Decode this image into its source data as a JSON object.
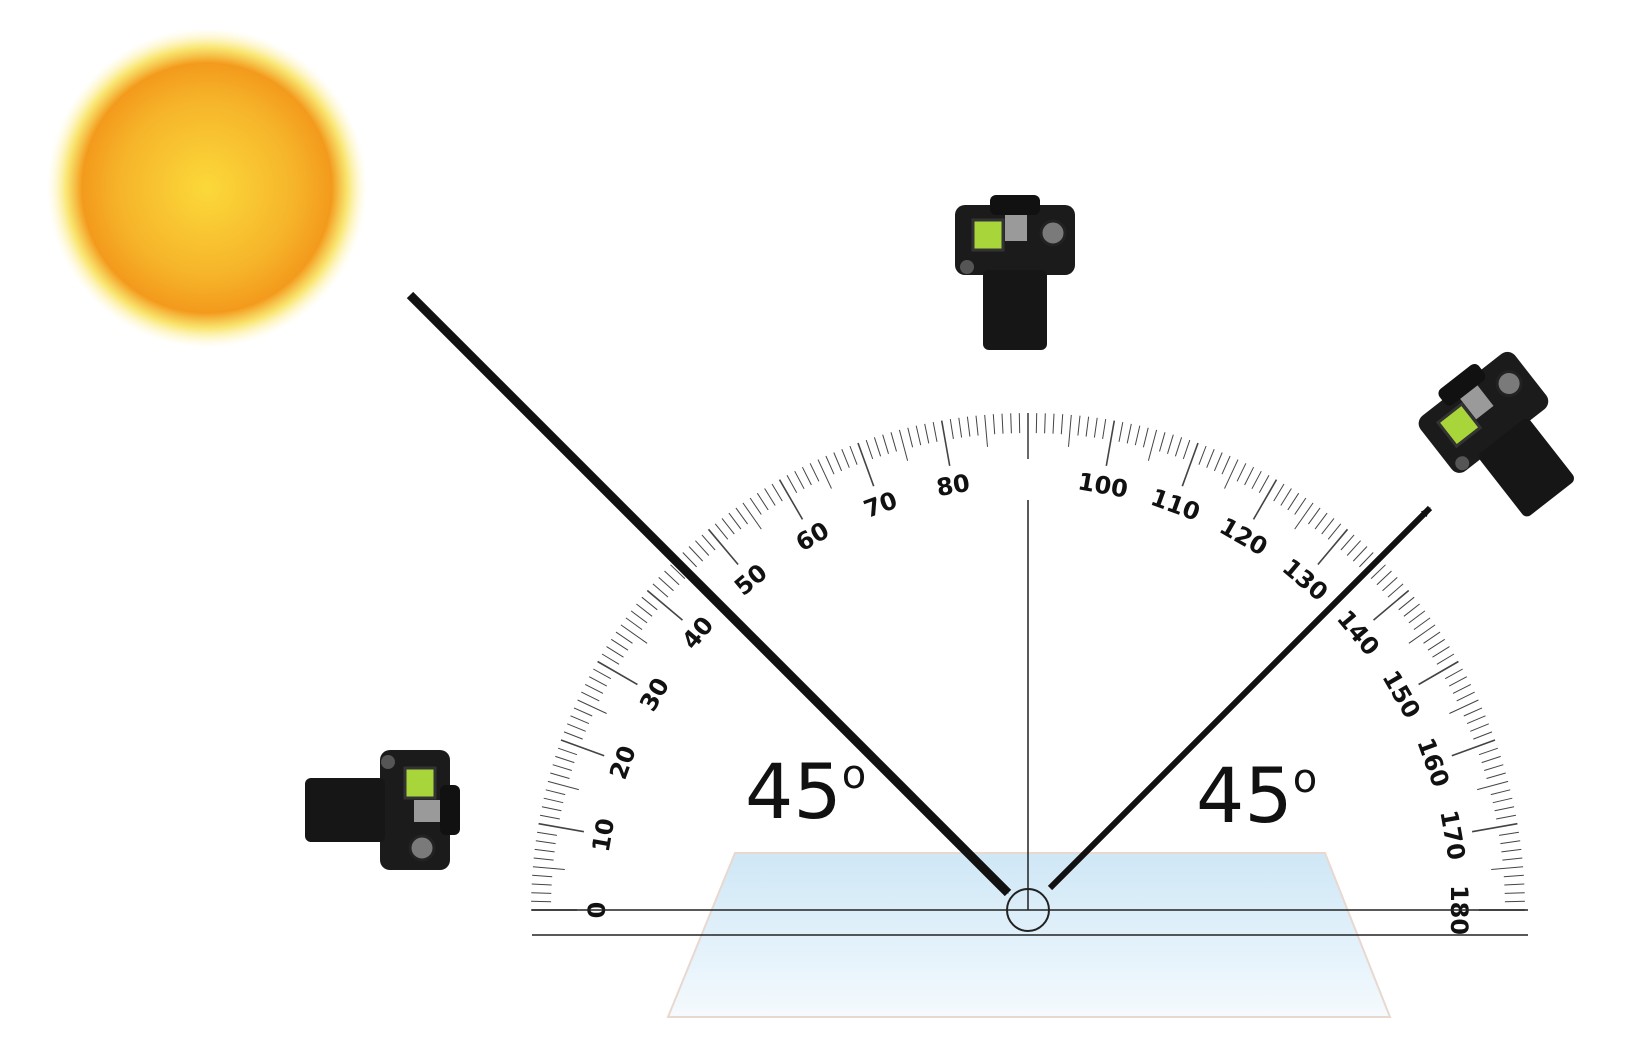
{
  "protractor": {
    "tick_labels": [
      "0",
      "10",
      "20",
      "30",
      "40",
      "50",
      "60",
      "70",
      "80",
      "100",
      "110",
      "120",
      "130",
      "140",
      "150",
      "160",
      "170",
      "180"
    ]
  },
  "angles": {
    "incident": {
      "value": "45",
      "symbol": "o"
    },
    "reflected": {
      "value": "45",
      "symbol": "o"
    }
  },
  "icons": {
    "sun": "sun-icon",
    "camera": "camera-icon"
  },
  "colors": {
    "sun_core": "#f7c52a",
    "sun_edge": "#f39a1c",
    "mirror": "#d6ebf7",
    "arrow": "#111111",
    "camera_screen": "#a8d63a"
  }
}
